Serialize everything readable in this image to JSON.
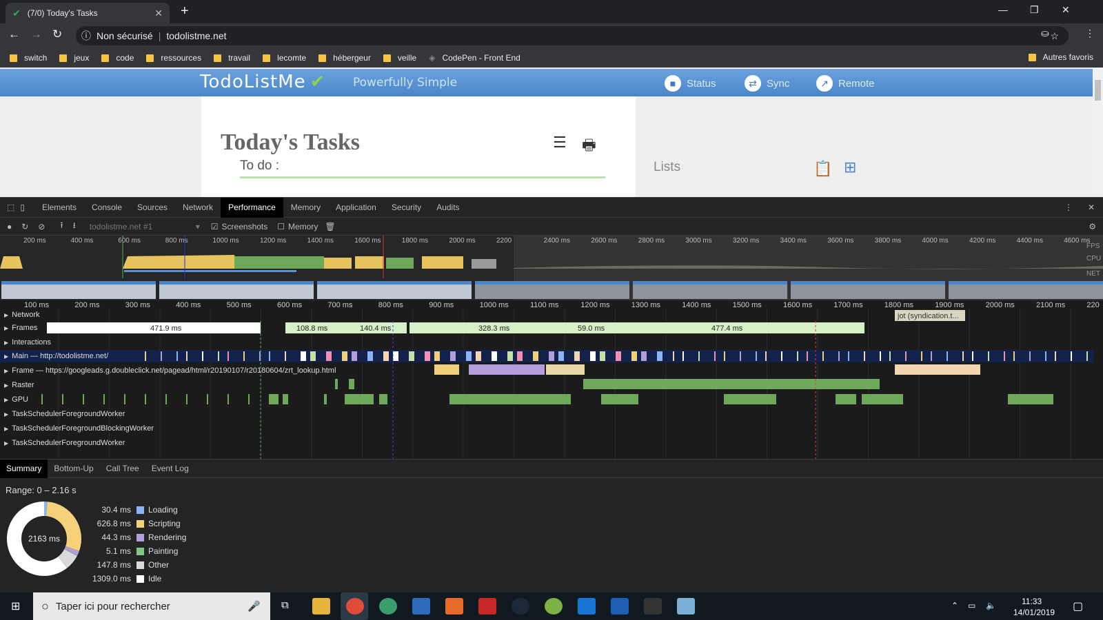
{
  "browser": {
    "tab_title": "(7/0) Today's Tasks",
    "address_security": "Non sécurisé",
    "address_url": "todolistme.net",
    "bookmarks": [
      "switch",
      "jeux",
      "code",
      "ressources",
      "travail",
      "lecomte",
      "hébergeur",
      "veille",
      "CodePen - Front End"
    ],
    "other_bookmarks": "Autres favoris"
  },
  "page": {
    "logo": "TodoListMe",
    "slogan": "Powerfully Simple",
    "buttons": [
      "Status",
      "Sync",
      "Remote"
    ],
    "heading": "Today's Tasks",
    "todo_label": "To do :",
    "lists_label": "Lists"
  },
  "devtools": {
    "tabs": [
      "Elements",
      "Console",
      "Sources",
      "Network",
      "Performance",
      "Memory",
      "Application",
      "Security",
      "Audits"
    ],
    "active_tab": "Performance",
    "target": "todolistme.net #1",
    "screenshots_label": "Screenshots",
    "memory_label": "Memory",
    "overview_ticks": [
      "200 ms",
      "400 ms",
      "600 ms",
      "800 ms",
      "1000 ms",
      "1200 ms",
      "1400 ms",
      "1600 ms",
      "1800 ms",
      "2000 ms",
      "2200",
      "2400 ms",
      "2600 ms",
      "2800 ms",
      "3000 ms",
      "3200 ms",
      "3400 ms",
      "3600 ms",
      "3800 ms",
      "4000 ms",
      "4200 ms",
      "4400 ms",
      "4600 ms"
    ],
    "overview_labels": [
      "FPS",
      "CPU",
      "NET"
    ],
    "timeline_ticks": [
      "100 ms",
      "200 ms",
      "300 ms",
      "400 ms",
      "500 ms",
      "600 ms",
      "700 ms",
      "800 ms",
      "900 ms",
      "1000 ms",
      "1100 ms",
      "1200 ms",
      "1300 ms",
      "1400 ms",
      "1500 ms",
      "1600 ms",
      "1700 ms",
      "1800 ms",
      "1900 ms",
      "2000 ms",
      "2100 ms",
      "220"
    ],
    "tracks": [
      "Network",
      "Frames",
      "Interactions",
      "Main — http://todolistme.net/",
      "Frame — https://googleads.g.doubleclick.net/pagead/html/r20190107/r20180604/zrt_lookup.html",
      "Raster",
      "GPU",
      "TaskSchedulerForegroundWorker",
      "TaskSchedulerForegroundBlockingWorker",
      "TaskSchedulerForegroundWorker"
    ],
    "frames": [
      "471.9 ms",
      "108.8 ms",
      "140.4 ms",
      "328.3 ms",
      "59.0 ms",
      "477.4 ms"
    ],
    "network_tooltip": "jot (syndication.t...",
    "bottom_tabs": [
      "Summary",
      "Bottom-Up",
      "Call Tree",
      "Event Log"
    ],
    "range": "Range: 0 – 2.16 s",
    "total": "2163 ms",
    "summary": [
      {
        "value": "30.4 ms",
        "label": "Loading",
        "color": "#8ab4f8"
      },
      {
        "value": "626.8 ms",
        "label": "Scripting",
        "color": "#f5d27a"
      },
      {
        "value": "44.3 ms",
        "label": "Rendering",
        "color": "#b39ddb"
      },
      {
        "value": "5.1 ms",
        "label": "Painting",
        "color": "#81c784"
      },
      {
        "value": "147.8 ms",
        "label": "Other",
        "color": "#dadada"
      },
      {
        "value": "1309.0 ms",
        "label": "Idle",
        "color": "#ffffff"
      }
    ]
  },
  "taskbar": {
    "search_placeholder": "Taper ici pour rechercher",
    "time": "11:33",
    "date": "14/01/2019"
  }
}
